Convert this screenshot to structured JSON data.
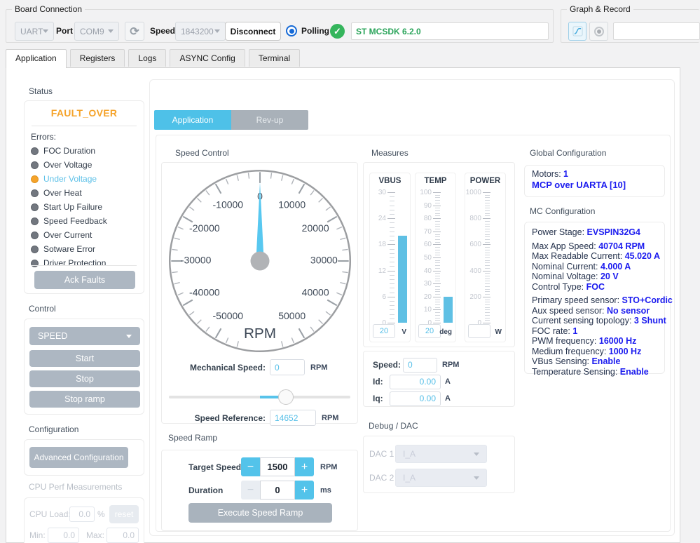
{
  "board_connection": {
    "legend": "Board Connection",
    "interface": "UART",
    "port_label": "Port",
    "port": "COM9",
    "speed_label": "Speed",
    "baud": "1843200",
    "disconnect_label": "Disconnect",
    "polling_label": "Polling",
    "firmware": "ST MCSDK 6.2.0"
  },
  "graph_record": {
    "legend": "Graph & Record",
    "record_file": ""
  },
  "tabs": {
    "items": [
      "Application",
      "Registers",
      "Logs",
      "ASYNC Config",
      "Terminal"
    ],
    "active_index": 0
  },
  "icons": {
    "check": "✓",
    "refresh": "⟳",
    "minus": "−",
    "plus": "+"
  },
  "sidebar": {
    "status_title": "Status",
    "fault": "FAULT_OVER",
    "errors_label": "Errors:",
    "errors": [
      {
        "label": "FOC Duration",
        "active": false
      },
      {
        "label": "Over Voltage",
        "active": false
      },
      {
        "label": "Under Voltage",
        "active": true
      },
      {
        "label": "Over Heat",
        "active": false
      },
      {
        "label": "Start Up Failure",
        "active": false
      },
      {
        "label": "Speed Feedback",
        "active": false
      },
      {
        "label": "Over Current",
        "active": false
      },
      {
        "label": "Sotware Error",
        "active": false
      },
      {
        "label": "Driver Protection",
        "active": false
      }
    ],
    "ack_faults": "Ack Faults",
    "control_title": "Control",
    "mode": "SPEED",
    "start": "Start",
    "stop": "Stop",
    "stop_ramp": "Stop ramp",
    "configuration_title": "Configuration",
    "advanced_configuration": "Advanced Configuration",
    "cpu_title": "CPU Perf Measurements",
    "cpu_load_label": "CPU Load:",
    "cpu_load": "0.0",
    "cpu_unit": "%",
    "reset_label": "reset",
    "min_label": "Min:",
    "min": "0.0",
    "max_label": "Max:",
    "max": "0.0"
  },
  "motor_tabs": {
    "application": "Application",
    "revup": "Rev-up"
  },
  "speed_control": {
    "title": "Speed Control",
    "mech_label": "Mechanical Speed:",
    "mech_value": "0",
    "mech_unit": "RPM",
    "ref_label": "Speed Reference:",
    "ref_value": "14652",
    "ref_unit": "RPM",
    "slider": {
      "min": -50000,
      "max": 50000,
      "value": 14652
    }
  },
  "speed_ramp": {
    "title": "Speed Ramp",
    "target_label": "Target Speed",
    "target_value": "1500",
    "target_unit": "RPM",
    "duration_label": "Duration",
    "duration_value": "0",
    "duration_unit": "ms",
    "execute_label": "Execute Speed Ramp"
  },
  "measures": {
    "title": "Measures",
    "speed_label": "Speed:",
    "speed_value": "0",
    "speed_unit": "RPM",
    "id_label": "Id:",
    "id_value": "0.00",
    "id_unit": "A",
    "iq_label": "Iq:",
    "iq_value": "0.00",
    "iq_unit": "A"
  },
  "debug_dac": {
    "title": "Debug / DAC",
    "dac1_label": "DAC 1",
    "dac1_value": "I_A",
    "dac2_label": "DAC 2",
    "dac2_value": "I_A"
  },
  "global_config": {
    "title": "Global Configuration",
    "motors_label": "Motors:",
    "motors_value": "1",
    "link": "MCP over UARTA [10]"
  },
  "mc_config": {
    "title": "MC Configuration",
    "items": [
      {
        "label": "Power Stage:",
        "value": "EVSPIN32G4",
        "group": 1
      },
      {
        "label": "Max App Speed:",
        "value": "40704 RPM",
        "group": 2
      },
      {
        "label": "Max Readable Current:",
        "value": "45.020 A",
        "group": 2
      },
      {
        "label": "Nominal Current:",
        "value": "4.000 A",
        "group": 2
      },
      {
        "label": "Nominal Voltage:",
        "value": "20 V",
        "group": 2
      },
      {
        "label": "Control Type:",
        "value": "FOC",
        "group": 2
      },
      {
        "label": "Primary speed sensor:",
        "value": "STO+Cordic",
        "group": 3
      },
      {
        "label": "Aux speed sensor:",
        "value": "No sensor",
        "group": 3
      },
      {
        "label": "Current sensing topology:",
        "value": "3 Shunt",
        "group": 3
      },
      {
        "label": "FOC rate:",
        "value": "1",
        "group": 3
      },
      {
        "label": "PWM frequency:",
        "value": "16000 Hz",
        "group": 3
      },
      {
        "label": "Medium frequency:",
        "value": "1000 Hz",
        "group": 3
      },
      {
        "label": "VBus Sensing:",
        "value": "Enable",
        "group": 3
      },
      {
        "label": "Temperature Sensing:",
        "value": "Enable",
        "group": 3
      }
    ]
  },
  "chart_data": [
    {
      "type": "gauge",
      "name": "speed-dial",
      "title": "RPM",
      "min": -50000,
      "max": 50000,
      "major_step": 10000,
      "minor_step": 2500,
      "tick_min": -55000,
      "tick_max": 55000,
      "half_span_deg": 150,
      "value": 0,
      "unit": "RPM",
      "needle_color": "#58c8f0"
    },
    {
      "type": "bar-gauge",
      "name": "vbus",
      "title": "VBUS",
      "min": 0,
      "max": 30,
      "major_step": 6,
      "minor_step": 1,
      "value": 20,
      "field": "20",
      "unit": "V"
    },
    {
      "type": "bar-gauge",
      "name": "temp",
      "title": "TEMP",
      "min": 0,
      "max": 100,
      "major_step": 10,
      "minor_step": 2,
      "value": 20,
      "field": "20",
      "unit": "deg"
    },
    {
      "type": "bar-gauge",
      "name": "power",
      "title": "POWER",
      "min": 0,
      "max": 1000,
      "major_step": 200,
      "minor_step": 20,
      "value": null,
      "field": "",
      "unit": "W"
    }
  ],
  "colors": {
    "accent_cyan": "#53c3ea",
    "fault_orange": "#f5a32a",
    "value_blue": "#1b1bef",
    "green": "#2aa45a",
    "button_gray": "#adb7c2"
  }
}
